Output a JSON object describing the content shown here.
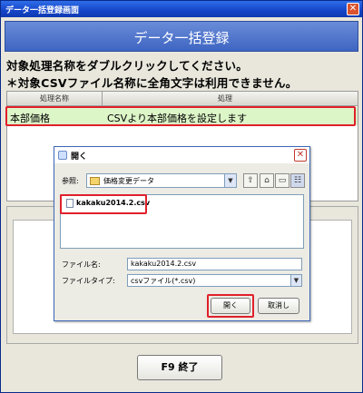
{
  "window": {
    "title": "データ一括登録画面"
  },
  "banner": {
    "title": "データ一括登録"
  },
  "instructions": [
    "対象処理名称をダブルクリックしてください。",
    "＊対象CSVファイル名称に全角文字は利用できません。"
  ],
  "grid": {
    "columns": [
      "処理名称",
      "処理"
    ],
    "rows": [
      {
        "name": "本部価格",
        "process": "CSVより本部価格を設定します"
      }
    ]
  },
  "dialog": {
    "title": "開く",
    "look_in_label": "参照:",
    "look_in_value": "価格変更データ",
    "files": [
      "kakaku2014.2.csv"
    ],
    "filename_label": "ファイル名:",
    "filename_value": "kakaku2014.2.csv",
    "filetype_label": "ファイルタイプ:",
    "filetype_value": "csvファイル(*.csv)",
    "open_button": "開く",
    "cancel_button": "取消し"
  },
  "footer": {
    "end_button": "F9 終了"
  },
  "colors": {
    "highlight": "#e0202a",
    "row_selected": "#ddf6c8",
    "banner": "#4a70c8"
  }
}
